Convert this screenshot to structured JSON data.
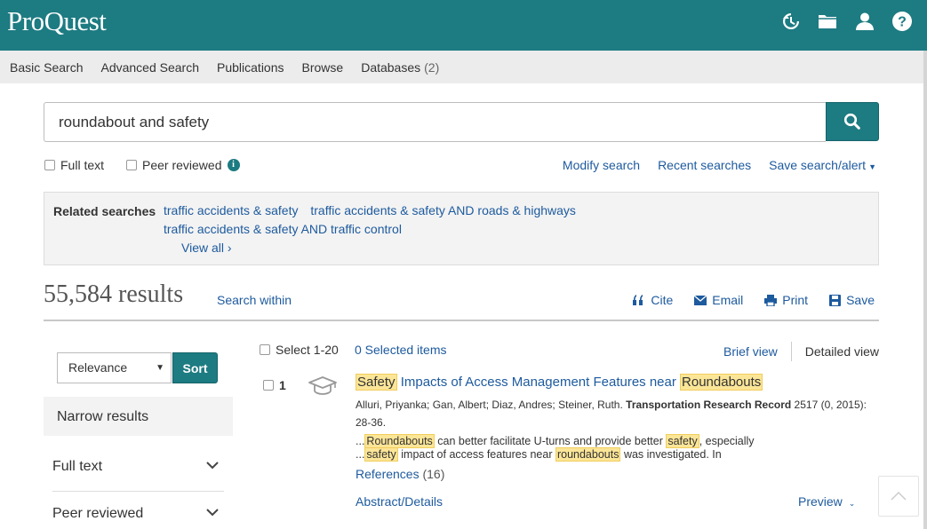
{
  "header": {
    "logo": "ProQuest",
    "icons": [
      "history-icon",
      "folder-icon",
      "user-icon",
      "help-icon"
    ]
  },
  "nav": {
    "items": [
      "Basic Search",
      "Advanced Search",
      "Publications",
      "Browse"
    ],
    "databases_label": "Databases",
    "databases_count": "(2)"
  },
  "search": {
    "query": "roundabout and safety",
    "full_text_label": "Full text",
    "peer_reviewed_label": "Peer reviewed",
    "modify": "Modify search",
    "recent": "Recent searches",
    "save": "Save search/alert"
  },
  "related": {
    "label": "Related searches",
    "items": [
      "traffic accidents & safety",
      "traffic accidents & safety AND roads & highways",
      "traffic accidents & safety AND traffic control"
    ],
    "view_all": "View all ›"
  },
  "results": {
    "count": "55,584 results",
    "search_within": "Search within",
    "actions": {
      "cite": "Cite",
      "email": "Email",
      "print": "Print",
      "save": "Save"
    },
    "select_label": "Select 1-20",
    "selected_items": "0 Selected items",
    "brief_view": "Brief view",
    "detailed_view": "Detailed view"
  },
  "sort": {
    "selected": "Relevance",
    "button": "Sort"
  },
  "narrow": {
    "heading": "Narrow results",
    "facets": [
      "Full text",
      "Peer reviewed"
    ]
  },
  "record": {
    "number": "1",
    "title_hl1": "Safety",
    "title_mid": " Impacts of Access Management Features near ",
    "title_hl2": "Roundabouts",
    "authors": "Alluri, Priyanka; Gan, Albert; Diaz, Andres; Steiner, Ruth.",
    "journal": "Transportation Research Record",
    "citation": " 2517  (0, 2015): 28-36.",
    "snip1_pre": "...",
    "snip1_hl1": "Roundabouts",
    "snip1_mid": " can better facilitate U-turns and provide better ",
    "snip1_hl2": "safety",
    "snip1_post": ", especially",
    "snip2_pre": "...",
    "snip2_hl1": "safety",
    "snip2_mid": " impact of access features near ",
    "snip2_hl2": "roundabouts",
    "snip2_post": " was investigated. In",
    "references_label": "References",
    "references_count": "(16)",
    "abstract_link": "Abstract/Details",
    "preview_link": "Preview"
  },
  "colors": {
    "brand": "#1d7b82",
    "link": "#1d5a9e",
    "highlight": "#fbe597"
  }
}
